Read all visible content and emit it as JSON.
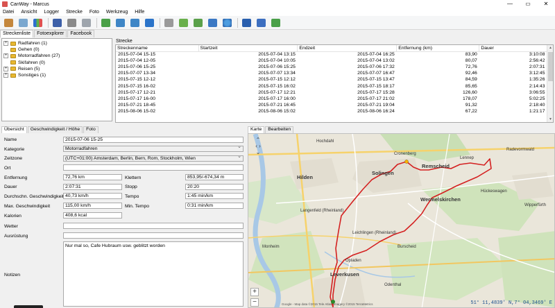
{
  "window": {
    "title": "CanWay - Marcus",
    "controls": [
      "—",
      "▭",
      "✕"
    ]
  },
  "menu": [
    "Datei",
    "Ansicht",
    "Logger",
    "Strecke",
    "Foto",
    "Werkzeug",
    "Hilfe"
  ],
  "toolbar_icons": [
    "open-icon",
    "edit-route-icon",
    "chart-icon",
    "save-icon",
    "print-icon",
    "delete-icon",
    "add-route-icon",
    "import-icon",
    "export-icon",
    "rotate-90-icon",
    "tools-icon",
    "gpx-icon",
    "gpx-export-icon",
    "sync-icon",
    "google-earth-icon",
    "book-icon",
    "help-icon",
    "exit-icon"
  ],
  "top_tabs": [
    "Streckenliste",
    "Fotoexplorer",
    "Facebook"
  ],
  "tree": [
    {
      "label": "Radfahren (1)"
    },
    {
      "label": "Gehen (0)"
    },
    {
      "label": "Motorradfahren (27)"
    },
    {
      "label": "Skifahren (0)"
    },
    {
      "label": "Reisen (5)"
    },
    {
      "label": "Sonstiges (1)"
    }
  ],
  "routes": {
    "label": "Strecke",
    "columns": [
      "Streckenname",
      "Startzeit",
      "Endzeit",
      "Entfernung (km)",
      "Dauer"
    ],
    "rows": [
      [
        "2015-07-04 15-15",
        "2015-07-04 13:15",
        "2015-07-04 16:25",
        "83,90",
        "3:10:08"
      ],
      [
        "2015-07-04 12-05",
        "2015-07-04 10:05",
        "2015-07-04 13:02",
        "80,07",
        "2:56:42"
      ],
      [
        "2015-07-06 15-25",
        "2015-07-06 15:25",
        "2015-07-06 17:32",
        "72,76",
        "2:07:31"
      ],
      [
        "2015-07-07 13-34",
        "2015-07-07 13:34",
        "2015-07-07 16:47",
        "92,46",
        "3:12:45"
      ],
      [
        "2015-07-15 12-12",
        "2015-07-15 12:12",
        "2015-07-15 13:47",
        "84,59",
        "1:35:26"
      ],
      [
        "2015-07-15 16-02",
        "2015-07-15 16:02",
        "2015-07-15 18:17",
        "85,65",
        "2:14:43"
      ],
      [
        "2015-07-17 12-21",
        "2015-07-17 12:21",
        "2015-07-17 15:28",
        "126,60",
        "3:06:55"
      ],
      [
        "2015-07-17 16-00",
        "2015-07-17 16:00",
        "2015-07-17 21:02",
        "178,07",
        "5:02:25"
      ],
      [
        "2015-07-21 18-45",
        "2015-07-21 16:45",
        "2015-07-21 19:04",
        "91,32",
        "2:18:40"
      ],
      [
        "2015-08-06 15-02",
        "2015-08-06 15:02",
        "2015-08-06 16:24",
        "67,22",
        "1:21:17"
      ]
    ]
  },
  "detail_tabs": [
    "Übersicht",
    "Geschwindigkeit / Höhe",
    "Foto"
  ],
  "form": {
    "name_label": "Name",
    "name": "2015-07-06 15-25",
    "kategorie_label": "Kategorie",
    "kategorie": "Motorradfahren",
    "zeitzone_label": "Zeitzone",
    "zeitzone": "(UTC+01:00) Amsterdam, Berlin, Bern, Rom, Stockholm, Wien",
    "ort_label": "Ort",
    "ort": "",
    "entfernung_label": "Entfernung",
    "entfernung": "72,76 km",
    "klettern_label": "Klettern",
    "klettern": "853,95/-674,34 m",
    "dauer_label": "Dauer",
    "dauer": "2:07:31",
    "stopp_label": "Stopp",
    "stopp": "20:20",
    "durchschnitt_label": "Durchschn. Geschwindigkeit",
    "durchschnitt": "40,73 km/h",
    "tempo_label": "Tempo",
    "tempo": "1:45 min/km",
    "maxgeschw_label": "Max. Geschwindigkeit",
    "maxgeschw": "115,00 km/h",
    "mintempo_label": "Min. Tempo",
    "mintempo": "0:31 min/km",
    "kalorien_label": "Kalorien",
    "kalorien": "408,6 kcal",
    "wetter_label": "Wetter",
    "wetter": "",
    "ausruestung_label": "Ausrüstung",
    "ausruestung": "",
    "notizen_label": "Notizen",
    "notizen": "Nur mal so, Cafe Hubraum usw. geblitzt worden"
  },
  "map": {
    "tabs": [
      "Karte",
      "Bearbeiten"
    ],
    "coords": "51° 11,4839' N,7° 04,3469' E",
    "copyright": "Google - Map data ©2015 Tele Atlas, Imagery ©2015 TerraMetrics",
    "zoom_plus": "+",
    "zoom_minus": "−",
    "labels": {
      "hochdahl": "Hochdahl",
      "hilden": "Hilden",
      "solingen": "Solingen",
      "remscheid": "Remscheid",
      "cronenberg": "Cronenberg",
      "langenfeld": "Langenfeld\n(Rheinland)",
      "leichlingen": "Leichlingen\n(Rheinland)",
      "wermelskirchen": "Wermelskirchen",
      "leverkusen": "Leverkusen",
      "burscheid": "Burscheid",
      "wipperfurth": "Wipperfürth",
      "odenthal": "Odenthal",
      "radevormwald": "Radevormwald",
      "hueckeswagen": "Hückeswagen",
      "lennep": "Lennep",
      "monheim": "Monheim",
      "opladen": "Opladen"
    },
    "route_color": "#d42020"
  }
}
